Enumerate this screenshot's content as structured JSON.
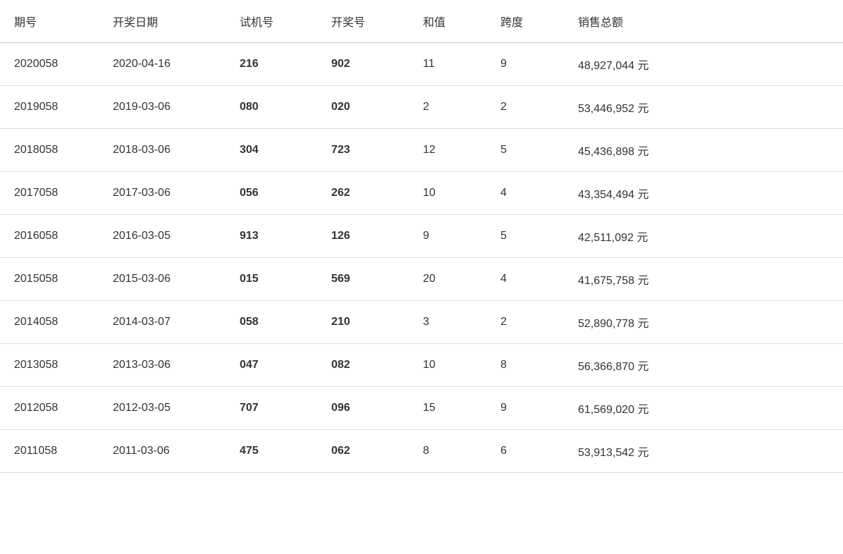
{
  "table": {
    "headers": [
      "期号",
      "开奖日期",
      "试机号",
      "开奖号",
      "和值",
      "跨度",
      "销售总额"
    ],
    "rows": [
      {
        "qihao": "2020058",
        "date": "2020-04-16",
        "shiji": "216",
        "kaijia": "902",
        "hezhi": "11",
        "kuadu": "9",
        "sales": "48,927,044 元"
      },
      {
        "qihao": "2019058",
        "date": "2019-03-06",
        "shiji": "080",
        "kaijia": "020",
        "hezhi": "2",
        "kuadu": "2",
        "sales": "53,446,952 元"
      },
      {
        "qihao": "2018058",
        "date": "2018-03-06",
        "shiji": "304",
        "kaijia": "723",
        "hezhi": "12",
        "kuadu": "5",
        "sales": "45,436,898 元"
      },
      {
        "qihao": "2017058",
        "date": "2017-03-06",
        "shiji": "056",
        "kaijia": "262",
        "hezhi": "10",
        "kuadu": "4",
        "sales": "43,354,494 元"
      },
      {
        "qihao": "2016058",
        "date": "2016-03-05",
        "shiji": "913",
        "kaijia": "126",
        "hezhi": "9",
        "kuadu": "5",
        "sales": "42,511,092 元"
      },
      {
        "qihao": "2015058",
        "date": "2015-03-06",
        "shiji": "015",
        "kaijia": "569",
        "hezhi": "20",
        "kuadu": "4",
        "sales": "41,675,758 元"
      },
      {
        "qihao": "2014058",
        "date": "2014-03-07",
        "shiji": "058",
        "kaijia": "210",
        "hezhi": "3",
        "kuadu": "2",
        "sales": "52,890,778 元"
      },
      {
        "qihao": "2013058",
        "date": "2013-03-06",
        "shiji": "047",
        "kaijia": "082",
        "hezhi": "10",
        "kuadu": "8",
        "sales": "56,366,870 元"
      },
      {
        "qihao": "2012058",
        "date": "2012-03-05",
        "shiji": "707",
        "kaijia": "096",
        "hezhi": "15",
        "kuadu": "9",
        "sales": "61,569,020 元"
      },
      {
        "qihao": "2011058",
        "date": "2011-03-06",
        "shiji": "475",
        "kaijia": "062",
        "hezhi": "8",
        "kuadu": "6",
        "sales": "53,913,542 元"
      }
    ]
  }
}
